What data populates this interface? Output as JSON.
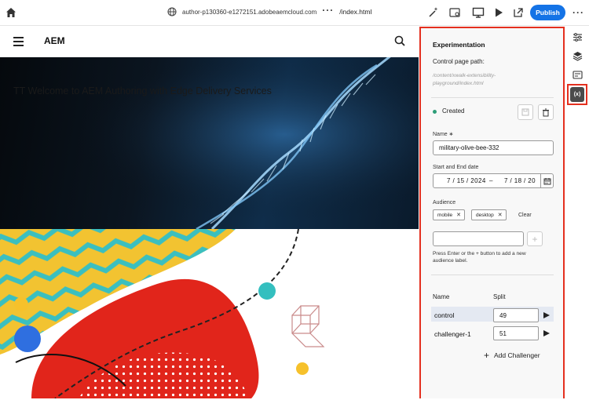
{
  "topbar": {
    "url": "author-p130360-e1272151.adobeaemcloud.com",
    "path": "/index.html",
    "publish_label": "Publish"
  },
  "page": {
    "logo": "AEM",
    "hero_title": "TT Welcome to AEM Authoring with Edge Delivery Services"
  },
  "panel": {
    "title": "Experimentation",
    "control_label": "Control page path:",
    "control_path": "/content/xwalk-extensibility-playground/index.html",
    "status": "Created",
    "name_label": "Name ∗",
    "name_value": "military-olive-bee-332",
    "date_label": "Start and End date",
    "start_date": "7 / 15 / 2024",
    "date_separator": "–",
    "end_date": "7 / 18 / 20",
    "audience_label": "Audience",
    "audience_tags": [
      "mobile",
      "desktop"
    ],
    "clear_label": "Clear",
    "help_text": "Press Enter or the + button to add a new audience label.",
    "table_headers": {
      "name": "Name",
      "split": "Split"
    },
    "variants": [
      {
        "name": "control",
        "split": "49"
      },
      {
        "name": "challenger-1",
        "split": "51"
      }
    ],
    "add_challenger_label": "Add Challenger"
  },
  "colors": {
    "accent": "#1473e6",
    "highlight_border": "#e4301f",
    "status_green": "#2d9d78"
  }
}
